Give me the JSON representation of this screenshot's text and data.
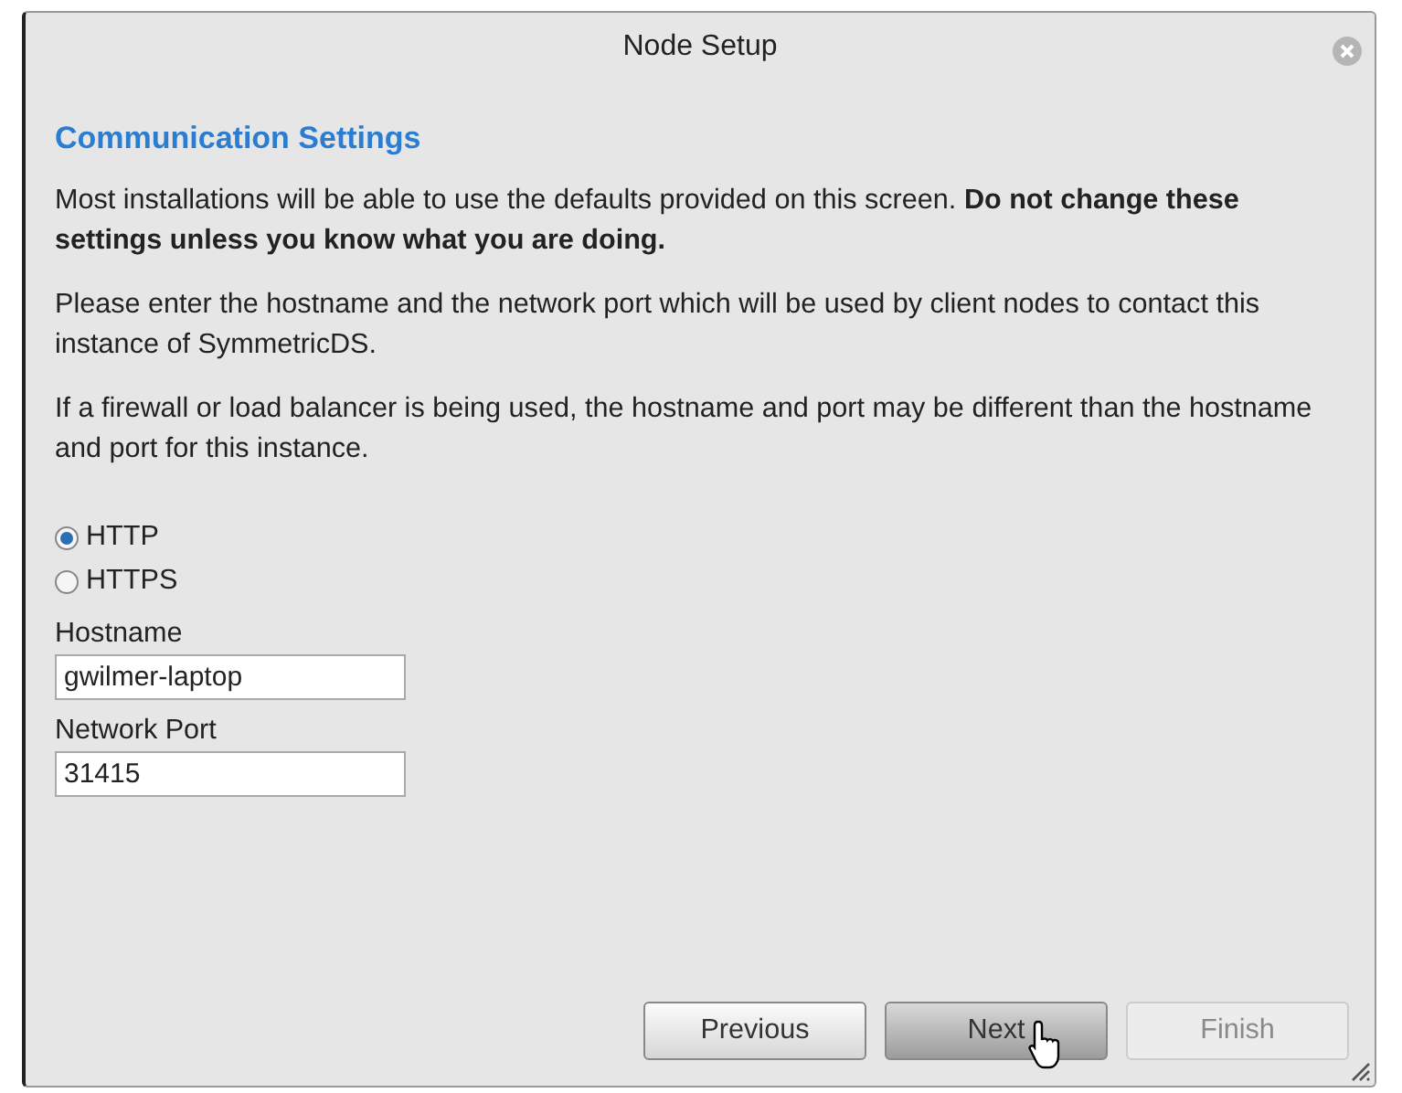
{
  "window": {
    "title": "Node Setup"
  },
  "heading": "Communication Settings",
  "paragraphs": [
    "Most installations will be able to use the defaults provided on this screen. **Do not change these settings unless you know what you are doing.**",
    "Please enter the hostname and the network port which will be used by client nodes to contact this instance of SymmetricDS.",
    "If a firewall or load balancer is being used, the hostname and port may be different than the hostname and port for this instance."
  ],
  "protocols": [
    {
      "label": "HTTP",
      "selected": true
    },
    {
      "label": "HTTPS",
      "selected": false
    }
  ],
  "fields": [
    {
      "label": "Hostname",
      "value": "gwilmer-laptop"
    },
    {
      "label": "Network Port",
      "value": "31415"
    }
  ],
  "buttons": [
    {
      "label": "Previous",
      "disabled": false,
      "hovered": false
    },
    {
      "label": "Next",
      "disabled": false,
      "hovered": true
    },
    {
      "label": "Finish",
      "disabled": true,
      "hovered": false
    }
  ]
}
